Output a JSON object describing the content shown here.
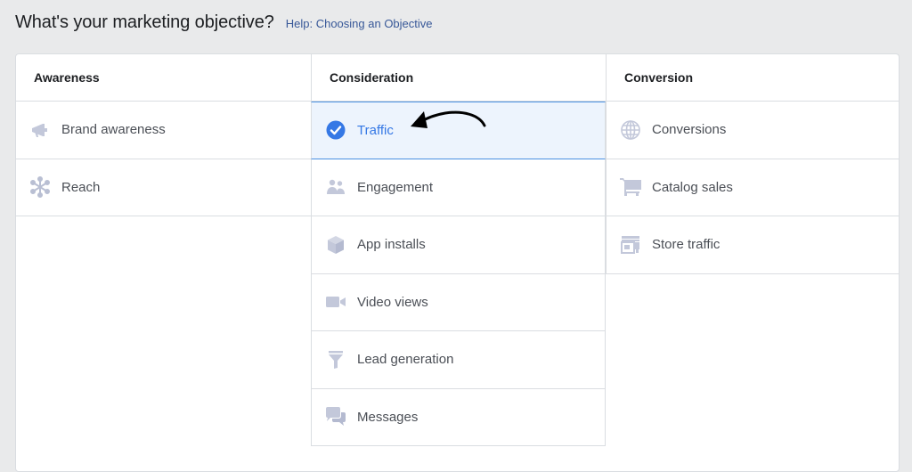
{
  "header": {
    "title": "What's your marketing objective?",
    "help_link": "Help: Choosing an Objective"
  },
  "columns": [
    {
      "heading": "Awareness",
      "items": [
        {
          "label": "Brand awareness",
          "icon": "megaphone-icon",
          "selected": false
        },
        {
          "label": "Reach",
          "icon": "reach-icon",
          "selected": false
        }
      ]
    },
    {
      "heading": "Consideration",
      "items": [
        {
          "label": "Traffic",
          "icon": "check-circle-icon",
          "selected": true
        },
        {
          "label": "Engagement",
          "icon": "people-icon",
          "selected": false
        },
        {
          "label": "App installs",
          "icon": "cube-icon",
          "selected": false
        },
        {
          "label": "Video views",
          "icon": "video-camera-icon",
          "selected": false
        },
        {
          "label": "Lead generation",
          "icon": "funnel-icon",
          "selected": false
        },
        {
          "label": "Messages",
          "icon": "chat-bubbles-icon",
          "selected": false
        }
      ]
    },
    {
      "heading": "Conversion",
      "items": [
        {
          "label": "Conversions",
          "icon": "globe-icon",
          "selected": false
        },
        {
          "label": "Catalog sales",
          "icon": "cart-icon",
          "selected": false
        },
        {
          "label": "Store traffic",
          "icon": "storefront-icon",
          "selected": false
        }
      ]
    }
  ],
  "colors": {
    "selected_accent": "#3578e5",
    "selected_background": "#edf4fd",
    "icon_muted": "#bec3d6",
    "annotation_arrow": "#000000"
  }
}
